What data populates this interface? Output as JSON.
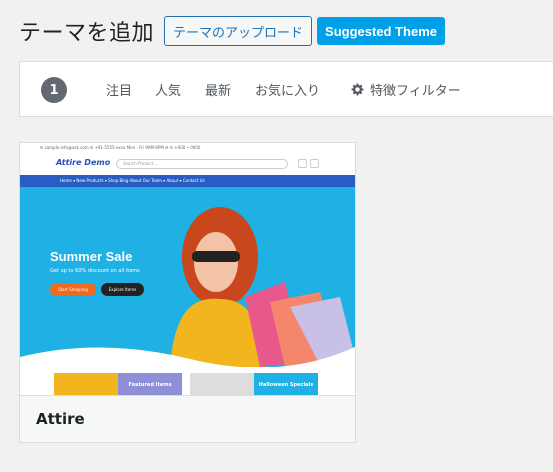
{
  "header": {
    "title": "テーマを追加",
    "upload_label": "テーマのアップロード",
    "suggested_label": "Suggested Theme"
  },
  "filter": {
    "count": "1",
    "tabs": [
      "注目",
      "人気",
      "最新",
      "お気に入り"
    ],
    "feature_filter_label": "特徴フィルター"
  },
  "theme": {
    "name": "Attire",
    "screenshot": {
      "topbar_text": "✉ sample.info@ask.com  ✆ +91-5555-xxxx  Mon - Fri 9AM-6PM  ✉  ✆  +000 • 0000",
      "logo": "Attire Demo",
      "search_placeholder": "Search Product...",
      "nav_items": "Home ▾   New Products ▾   Shop   Blog   About Our Team ▾   About ▾   Contact Us",
      "hero_title": "Summer Sale",
      "hero_subtitle": "Get up to 60% discount on all items",
      "btn_shop": "Start Shopping",
      "btn_explore": "Explore Items",
      "card_featured": "Featured Items",
      "card_halloween": "Halloween Specials"
    }
  },
  "colors": {
    "accent": "#2271b1",
    "suggested_bg": "#00a0e8",
    "badge_bg": "#646970",
    "hero_bg": "#1fb0e4",
    "nav_bg": "#2a5dc4",
    "shop_btn": "#f06a1d"
  }
}
